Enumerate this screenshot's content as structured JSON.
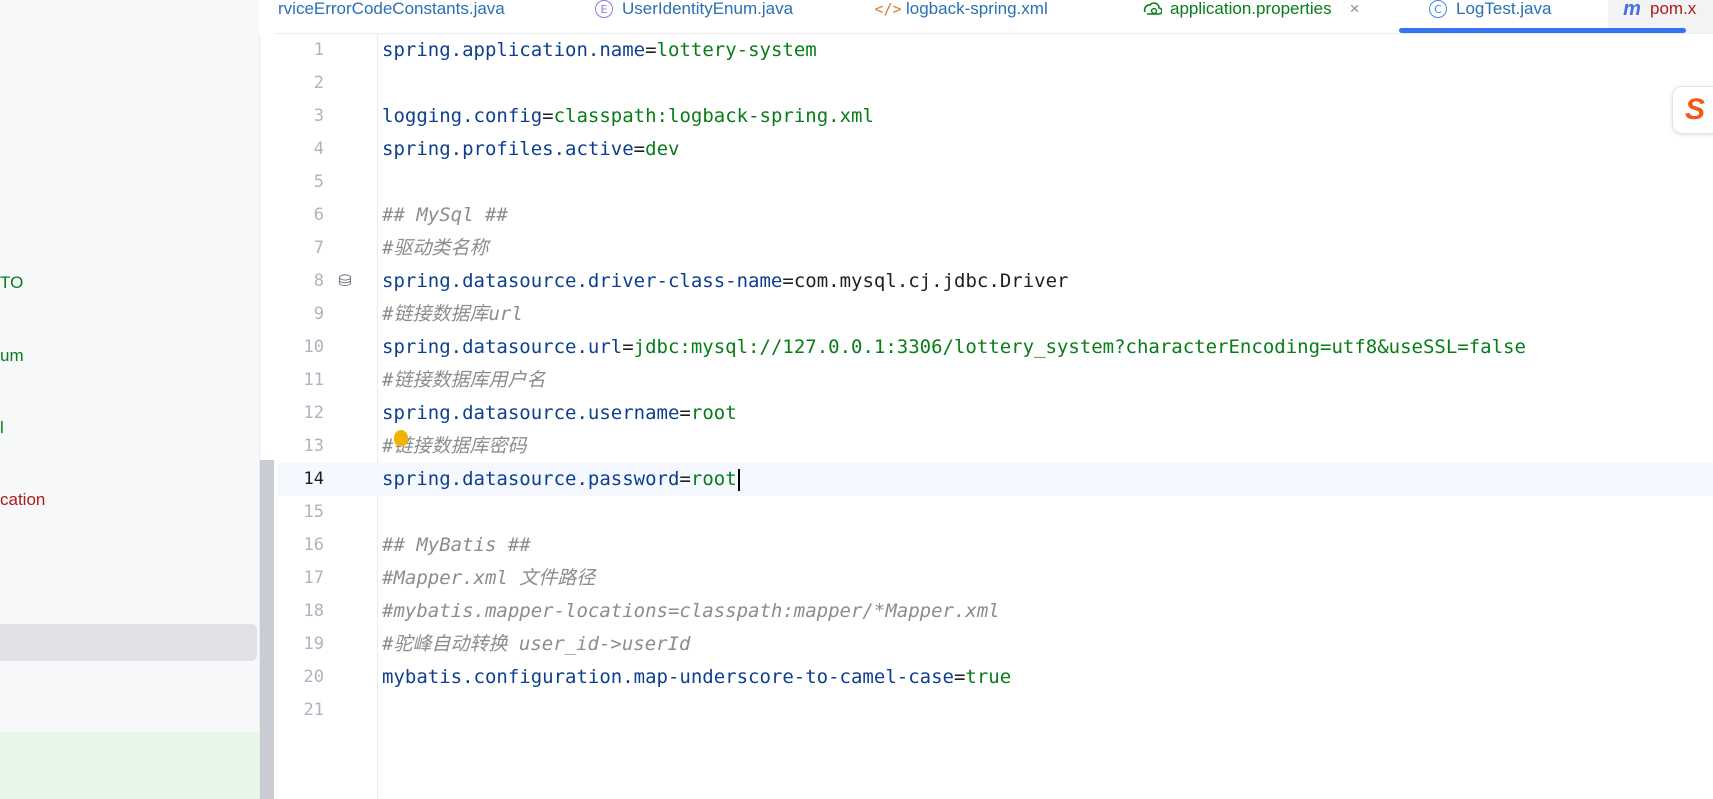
{
  "sidebar": {
    "items": [
      {
        "label": "TO",
        "color": "green"
      },
      {
        "label": "um",
        "color": "green"
      },
      {
        "label": "l",
        "color": "green"
      },
      {
        "label": "cation",
        "color": "red"
      }
    ]
  },
  "tabs": [
    {
      "label": "rviceErrorCodeConstants.java",
      "icon": "none"
    },
    {
      "label": "UserIdentityEnum.java",
      "icon": "enum-icon",
      "icon_glyph": "E"
    },
    {
      "label": "logback-spring.xml",
      "icon": "xml-icon",
      "icon_glyph": "</>"
    },
    {
      "label": "application.properties",
      "icon": "properties-icon",
      "active": true
    },
    {
      "label": "LogTest.java",
      "icon": "class-icon",
      "icon_glyph": "C"
    },
    {
      "label": "pom.x",
      "icon": "maven-icon",
      "icon_glyph": "m"
    }
  ],
  "tab_close_glyph": "×",
  "editor": {
    "current_line": 14,
    "lines": [
      {
        "n": "1",
        "parts": [
          [
            "k",
            "spring.application.name"
          ],
          [
            "eq",
            "="
          ],
          [
            "v",
            "lottery-system"
          ]
        ]
      },
      {
        "n": "2",
        "parts": []
      },
      {
        "n": "3",
        "parts": [
          [
            "k",
            "logging.config"
          ],
          [
            "eq",
            "="
          ],
          [
            "v",
            "classpath:logback-spring.xml"
          ]
        ]
      },
      {
        "n": "4",
        "parts": [
          [
            "k",
            "spring.profiles.active"
          ],
          [
            "eq",
            "="
          ],
          [
            "v",
            "dev"
          ]
        ]
      },
      {
        "n": "5",
        "parts": []
      },
      {
        "n": "6",
        "parts": [
          [
            "cm",
            "## MySql ##"
          ]
        ]
      },
      {
        "n": "7",
        "parts": [
          [
            "cm",
            "#驱动类名称"
          ]
        ]
      },
      {
        "n": "8",
        "parts": [
          [
            "k",
            "spring.datasource.driver-class-name"
          ],
          [
            "eq",
            "="
          ],
          [
            "vb",
            "com"
          ],
          [
            "dot",
            "."
          ],
          [
            "vb",
            "mysql"
          ],
          [
            "dot",
            "."
          ],
          [
            "vb",
            "cj"
          ],
          [
            "dot",
            "."
          ],
          [
            "vb",
            "jdbc"
          ],
          [
            "dot",
            "."
          ],
          [
            "vb",
            "Driver"
          ]
        ]
      },
      {
        "n": "9",
        "parts": [
          [
            "cm",
            "#链接数据库url"
          ]
        ]
      },
      {
        "n": "10",
        "parts": [
          [
            "k",
            "spring.datasource.url"
          ],
          [
            "eq",
            "="
          ],
          [
            "v",
            "jdbc:mysql://127.0.0.1:3306/lottery_system?characterEncoding=utf8&useSSL=false"
          ]
        ]
      },
      {
        "n": "11",
        "parts": [
          [
            "cm",
            "#链接数据库用户名"
          ]
        ]
      },
      {
        "n": "12",
        "parts": [
          [
            "k",
            "spring.datasource.username"
          ],
          [
            "eq",
            "="
          ],
          [
            "v",
            "root"
          ]
        ]
      },
      {
        "n": "13",
        "parts": [
          [
            "cm",
            "#链接数据库密码"
          ]
        ]
      },
      {
        "n": "14",
        "parts": [
          [
            "k",
            "spring.datasource.password"
          ],
          [
            "eq",
            "="
          ],
          [
            "v",
            "root"
          ]
        ]
      },
      {
        "n": "15",
        "parts": []
      },
      {
        "n": "16",
        "parts": [
          [
            "cm",
            "## MyBatis ##"
          ]
        ]
      },
      {
        "n": "17",
        "parts": [
          [
            "cm",
            "#Mapper.xml 文件路径"
          ]
        ]
      },
      {
        "n": "18",
        "parts": [
          [
            "cm",
            "#mybatis.mapper-locations=classpath:mapper/*Mapper.xml"
          ]
        ]
      },
      {
        "n": "19",
        "parts": [
          [
            "cm",
            "#驼峰自动转换 user_id->userId"
          ]
        ]
      },
      {
        "n": "20",
        "parts": [
          [
            "k",
            "mybatis.configuration.map-underscore-to-camel-case"
          ],
          [
            "eq",
            "="
          ],
          [
            "v",
            "true"
          ]
        ]
      },
      {
        "n": "21",
        "parts": []
      }
    ],
    "gutter_icons": [
      {
        "line": 8,
        "icon": "database-icon",
        "glyph": "⛁"
      }
    ],
    "intention_bulb_line": 13
  },
  "floating_logo": {
    "icon": "sogou-ime-icon",
    "glyph": "S"
  }
}
